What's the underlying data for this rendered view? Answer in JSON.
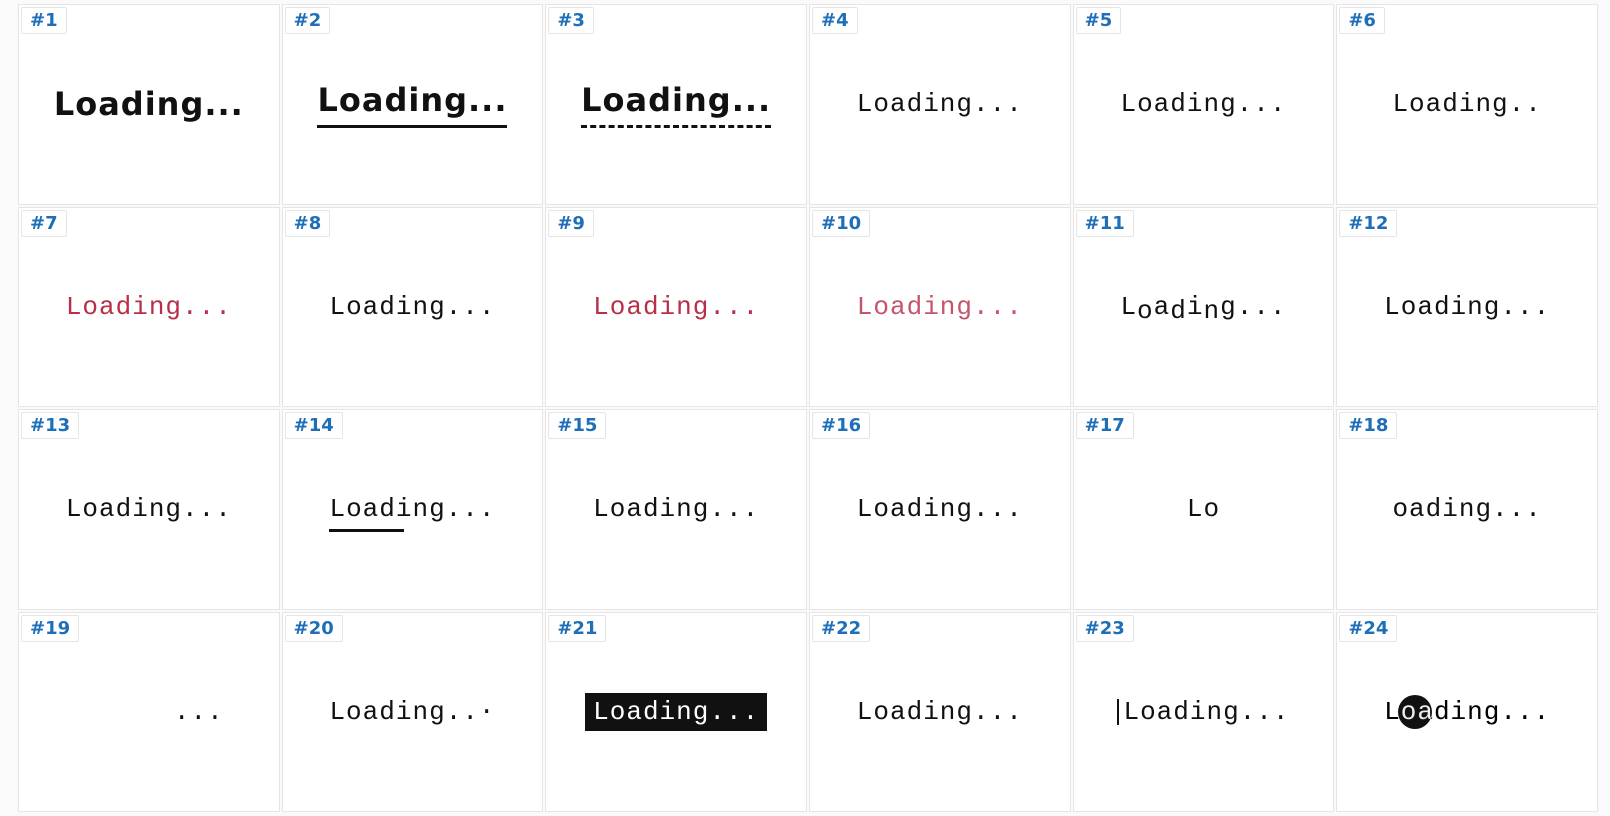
{
  "loading_label": "Loading...",
  "cells": [
    {
      "id": "1",
      "badge": "#1",
      "text": "Loading...",
      "variant": "bold-sans"
    },
    {
      "id": "2",
      "badge": "#2",
      "text": "Loading...",
      "variant": "bold-sans-underline"
    },
    {
      "id": "3",
      "badge": "#3",
      "text": "Loading...",
      "variant": "bold-sans-dashed"
    },
    {
      "id": "4",
      "badge": "#4",
      "text": "Loading...",
      "variant": "mono"
    },
    {
      "id": "5",
      "badge": "#5",
      "text": "Loading...",
      "variant": "mono"
    },
    {
      "id": "6",
      "badge": "#6",
      "text": "Loading..",
      "variant": "mono"
    },
    {
      "id": "7",
      "badge": "#7",
      "text": "Loading...",
      "variant": "mono-red"
    },
    {
      "id": "8",
      "badge": "#8",
      "text": "Loading...",
      "variant": "mono"
    },
    {
      "id": "9",
      "badge": "#9",
      "text": "Loading...",
      "variant": "mono-red"
    },
    {
      "id": "10",
      "badge": "#10",
      "text": "Loading...",
      "variant": "mono-red-light"
    },
    {
      "id": "11",
      "badge": "#11",
      "text": "Loading...",
      "variant": "mono-wavy"
    },
    {
      "id": "12",
      "badge": "#12",
      "text": "Loading...",
      "variant": "mono"
    },
    {
      "id": "13",
      "badge": "#13",
      "text": "Loading...",
      "variant": "mono"
    },
    {
      "id": "14",
      "badge": "#14",
      "text": "Loading...",
      "variant": "mono-underline-partial"
    },
    {
      "id": "15",
      "badge": "#15",
      "text": "Loading...",
      "variant": "mono"
    },
    {
      "id": "16",
      "badge": "#16",
      "text": "Loading...",
      "variant": "mono"
    },
    {
      "id": "17",
      "badge": "#17",
      "text": "Lo",
      "variant": "mono"
    },
    {
      "id": "18",
      "badge": "#18",
      "text": "oading...",
      "variant": "mono"
    },
    {
      "id": "19",
      "badge": "#19",
      "text": "...",
      "variant": "mono-right"
    },
    {
      "id": "20",
      "badge": "#20",
      "text": "Loading...",
      "variant": "mono-lastdot-high"
    },
    {
      "id": "21",
      "badge": "#21",
      "text": "Loading...",
      "variant": "mono-inverse"
    },
    {
      "id": "22",
      "badge": "#22",
      "text": "Loading...",
      "variant": "mono"
    },
    {
      "id": "23",
      "badge": "#23",
      "text": "Loading...",
      "variant": "mono-cursor"
    },
    {
      "id": "24",
      "badge": "#24",
      "text": "Loading...",
      "variant": "mono-dot-overlay"
    }
  ]
}
